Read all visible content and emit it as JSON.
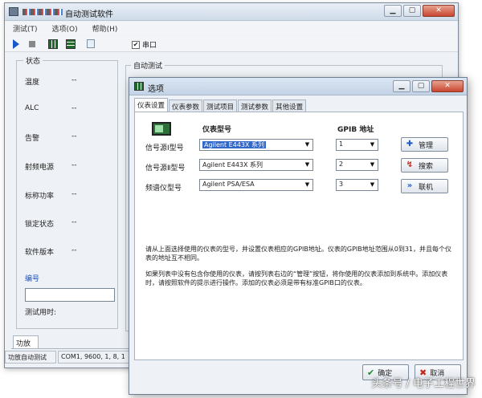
{
  "main_window": {
    "title": "自动测试软件",
    "menu": [
      "测试(T)",
      "选项(O)",
      "帮助(H)"
    ],
    "toolbar": {
      "serial_label": "串口",
      "serial_checked": true
    },
    "status_group": {
      "title": "状态",
      "rows": [
        {
          "label": "温度",
          "value": "--"
        },
        {
          "label": "ALC",
          "value": "--"
        },
        {
          "label": "告警",
          "value": "--"
        },
        {
          "label": "射频电源",
          "value": "--"
        },
        {
          "label": "标称功率",
          "value": "--"
        },
        {
          "label": "锁定状态",
          "value": "--"
        },
        {
          "label": "软件版本",
          "value": "--"
        }
      ],
      "id_label": "编号",
      "id_value": "",
      "test_time_label": "测试用时:"
    },
    "auto_test_title": "自动测试",
    "bottom_tab": "功放",
    "status_bar": [
      "功放自动测试",
      "COM1, 9600, 1, 8, 1"
    ]
  },
  "dialog": {
    "title": "选项",
    "tabs": [
      "仪表设置",
      "仪表参数",
      "测试项目",
      "测试参数",
      "其他设置"
    ],
    "active_tab": 0,
    "header_model": "仪表型号",
    "header_gpib": "GPIB 地址",
    "rows": [
      {
        "label": "信号源Ⅰ型号",
        "model": "Agilent E443X 系列",
        "gpib": "1"
      },
      {
        "label": "信号源Ⅱ型号",
        "model": "Agilent E443X 系列",
        "gpib": "2"
      },
      {
        "label": "频谱仪型号",
        "model": "Agilent PSA/ESA",
        "gpib": "3"
      }
    ],
    "side_buttons": [
      {
        "label": "管理",
        "icon": "plus-icon"
      },
      {
        "label": "搜索",
        "icon": "search-icon"
      },
      {
        "label": "联机",
        "icon": "connect-icon"
      }
    ],
    "help_1": "请从上面选择使用的仪表的型号，并设置仪表相应的GPIB地址。仪表的GPIB地址范围从0到31，并且每个仪表的地址互不相同。",
    "help_2": "如果列表中没有包含你使用的仪表，请按列表右边的“管理”按钮，将你使用的仪表添加到系统中。添加仪表时，请按照软件的提示进行操作。添加的仪表必须是带有标准GPIB口的仪表。",
    "ok_label": "确定",
    "cancel_label": "取消"
  },
  "watermark": "头条号 / 电子工程世界"
}
